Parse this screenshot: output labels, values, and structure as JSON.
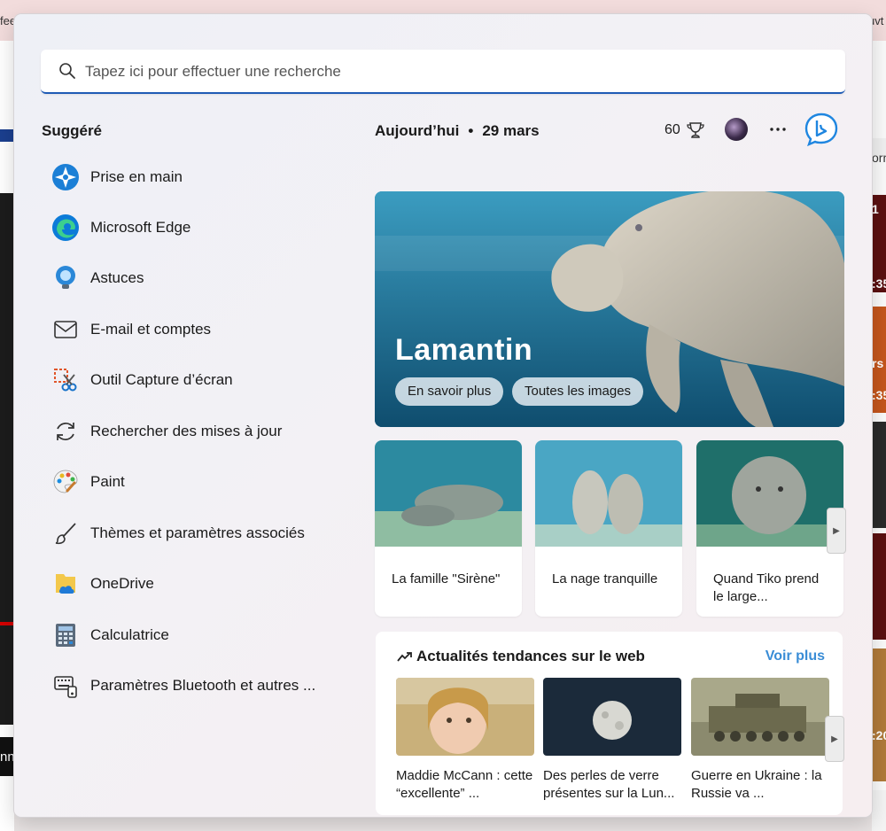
{
  "background": {
    "top_fragments": [
      "fee",
      "uvt"
    ],
    "left_fragment": "nn",
    "right_fragments": [
      "orm",
      "1",
      ":35",
      "rs",
      ":35",
      ":20"
    ]
  },
  "search": {
    "placeholder": "Tapez ici pour effectuer une recherche"
  },
  "suggested": {
    "title": "Suggéré",
    "items": [
      {
        "label": "Prise en main",
        "icon": "getstarted-icon"
      },
      {
        "label": "Microsoft Edge",
        "icon": "edge-icon"
      },
      {
        "label": "Astuces",
        "icon": "tips-icon"
      },
      {
        "label": "E-mail et comptes",
        "icon": "mail-icon"
      },
      {
        "label": "Outil Capture d’écran",
        "icon": "snipping-tool-icon"
      },
      {
        "label": "Rechercher des mises à jour",
        "icon": "refresh-icon"
      },
      {
        "label": "Paint",
        "icon": "paint-icon"
      },
      {
        "label": "Thèmes et paramètres associés",
        "icon": "brush-icon"
      },
      {
        "label": "OneDrive",
        "icon": "onedrive-icon"
      },
      {
        "label": "Calculatrice",
        "icon": "calculator-icon"
      },
      {
        "label": "Paramètres Bluetooth et autres ...",
        "icon": "bluetooth-devices-icon"
      }
    ]
  },
  "header": {
    "today_label": "Aujourd’hui",
    "separator": "•",
    "date": "29 mars",
    "points": "60"
  },
  "hero": {
    "title": "Lamantin",
    "btn_learn": "En savoir plus",
    "btn_images": "Toutes les images"
  },
  "cards": [
    {
      "caption": "La famille \"Sirène\""
    },
    {
      "caption": "La nage tranquille"
    },
    {
      "caption": "Quand Tiko prend le large..."
    }
  ],
  "trending": {
    "title": "Actualités tendances sur le web",
    "more": "Voir plus",
    "items": [
      {
        "caption": "Maddie McCann : cette “excellente” ..."
      },
      {
        "caption": "Des perles de verre présentes sur la Lun..."
      },
      {
        "caption": "Guerre en Ukraine : la Russie va ..."
      }
    ]
  },
  "colors": {
    "accent": "#1f5bb5",
    "link": "#3a8dd6"
  }
}
